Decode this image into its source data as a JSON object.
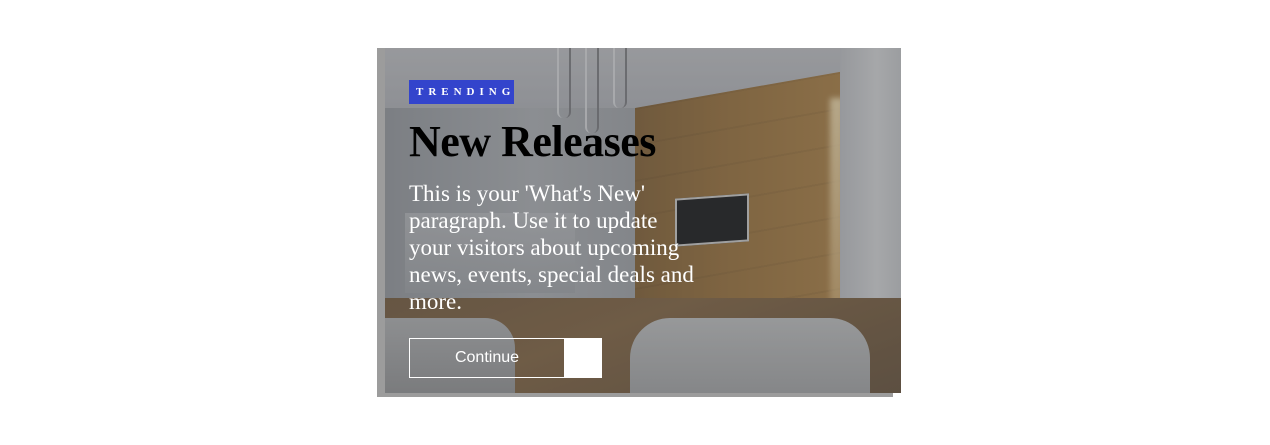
{
  "card": {
    "tag": "TRENDING",
    "title": "New Releases",
    "paragraph": "This is your 'What's New' paragraph. Use it to update your visitors about upcoming news, events, special deals and more.",
    "button_label": "Continue"
  },
  "colors": {
    "tag_background": "#3344cc",
    "title_color": "#000000",
    "paragraph_color": "#ffffff",
    "button_border": "#ffffff"
  },
  "background_image": {
    "icon": "living-room-photo"
  }
}
